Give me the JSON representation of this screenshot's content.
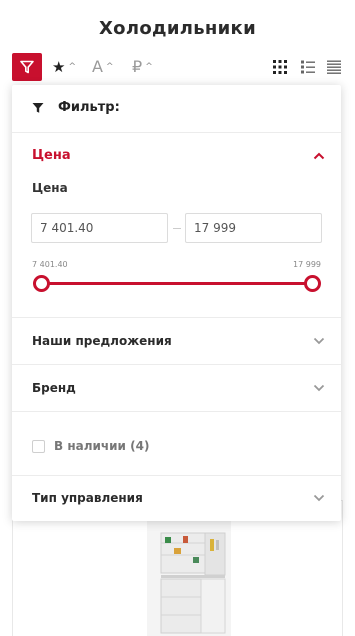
{
  "page": {
    "title": "Холодильники"
  },
  "toolbar": {
    "icons": {
      "filter": "filter-icon",
      "rating": "star-icon",
      "alpha": "letter-a-icon",
      "price": "ruble-icon",
      "grid": "grid-view-icon",
      "list": "list-view-icon",
      "table": "table-view-icon"
    },
    "sort_rating_glyph": "★",
    "sort_alpha_glyph": "A",
    "sort_price_glyph": "₽",
    "sort_arrow_glyph": "^"
  },
  "filter": {
    "header": "Фильтр:",
    "price": {
      "title": "Цена",
      "subtitle": "Цена",
      "from_value": "7 401.40",
      "to_value": "17 999",
      "range_min_label": "7 401.40",
      "range_max_label": "17 999",
      "expanded": true
    },
    "sections": {
      "offers": "Наши предложения",
      "brand": "Бренд",
      "control_type": "Тип управления"
    },
    "in_stock": {
      "label": "В наличии (4)",
      "checked": false
    }
  },
  "colors": {
    "accent": "#c8102e",
    "text": "#2b2b2b",
    "muted": "#888888",
    "border": "#ececec"
  }
}
